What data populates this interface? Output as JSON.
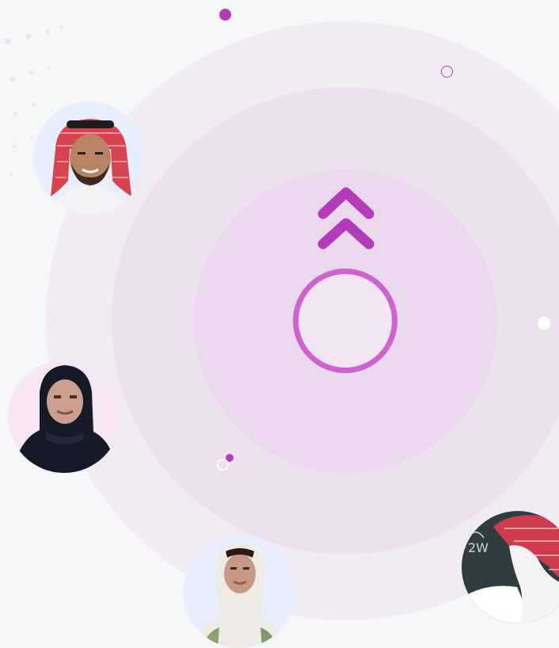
{
  "colors": {
    "background": "#f6f7f9",
    "ring_outer": "#f1ecf4",
    "ring_middle": "#ede1ef",
    "ring_inner": "#ead9ec",
    "accent": "#b33db9",
    "center_ring": "#cd62d0"
  },
  "icons": {
    "center": "double-chevron-up-icon",
    "ring": "circle-ring-icon"
  },
  "avatars": [
    {
      "name": "avatar-man-shemagh-top-left",
      "bg": "#e8eefb"
    },
    {
      "name": "avatar-woman-hijab-left",
      "bg": "#f7e6f6"
    },
    {
      "name": "avatar-woman-hijab-bottom",
      "bg": "#e8eefb"
    },
    {
      "name": "avatar-man-shemagh-bottom-right",
      "bg": "#2f3d40"
    }
  ]
}
